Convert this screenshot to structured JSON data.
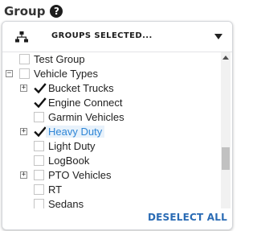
{
  "header": {
    "title": "Group",
    "help_glyph": "?"
  },
  "selector": {
    "label": "GROUPS SELECTED...",
    "icon": "org-chart-icon"
  },
  "tree": {
    "items": [
      {
        "label": "Test Group",
        "checked": false,
        "expander": "",
        "highlight": false,
        "level": 0
      },
      {
        "label": "Vehicle Types",
        "checked": false,
        "expander": "−",
        "highlight": false,
        "level": 0
      },
      {
        "label": "Bucket Trucks",
        "checked": true,
        "expander": "+",
        "highlight": false,
        "level": 1
      },
      {
        "label": "Engine Connect",
        "checked": true,
        "expander": "",
        "highlight": false,
        "level": 1
      },
      {
        "label": "Garmin Vehicles",
        "checked": false,
        "expander": "",
        "highlight": false,
        "level": 1
      },
      {
        "label": "Heavy Duty",
        "checked": true,
        "expander": "+",
        "highlight": true,
        "level": 1
      },
      {
        "label": "Light Duty",
        "checked": false,
        "expander": "",
        "highlight": false,
        "level": 1
      },
      {
        "label": "LogBook",
        "checked": false,
        "expander": "",
        "highlight": false,
        "level": 1
      },
      {
        "label": "PTO Vehicles",
        "checked": false,
        "expander": "+",
        "highlight": false,
        "level": 1
      },
      {
        "label": "RT",
        "checked": false,
        "expander": "",
        "highlight": false,
        "level": 1
      },
      {
        "label": "Sedans",
        "checked": false,
        "expander": "",
        "highlight": false,
        "level": 1
      }
    ]
  },
  "actions": {
    "deselect_all": "DESELECT ALL"
  },
  "colors": {
    "accent": "#2a6bb4",
    "highlight_text": "#2f86d6"
  }
}
